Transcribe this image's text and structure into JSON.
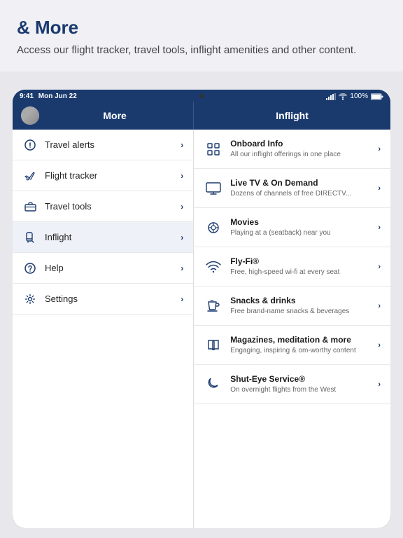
{
  "page": {
    "background_color": "#e8e8ec"
  },
  "top": {
    "title": "& More",
    "subtitle": "Access our flight tracker, travel tools, inflight amenities and other content."
  },
  "status_bar": {
    "time": "9:41",
    "date": "Mon Jun 22",
    "battery": "100%"
  },
  "left_nav": {
    "title": "More",
    "items": [
      {
        "id": "travel-alerts",
        "label": "Travel alerts",
        "icon": "alert-circle",
        "active": false
      },
      {
        "id": "flight-tracker",
        "label": "Flight tracker",
        "icon": "plane",
        "active": false
      },
      {
        "id": "travel-tools",
        "label": "Travel tools",
        "icon": "briefcase",
        "active": false
      },
      {
        "id": "inflight",
        "label": "Inflight",
        "icon": "seat",
        "active": true
      },
      {
        "id": "help",
        "label": "Help",
        "icon": "help-circle",
        "active": false
      },
      {
        "id": "settings",
        "label": "Settings",
        "icon": "gear",
        "active": false
      }
    ]
  },
  "right_nav": {
    "title": "Inflight",
    "items": [
      {
        "id": "onboard-info",
        "title": "Onboard Info",
        "subtitle": "All our inflight offerings in one place",
        "icon": "grid"
      },
      {
        "id": "live-tv",
        "title": "Live TV & On Demand",
        "subtitle": "Dozens of channels of free DIRECTV...",
        "icon": "tv"
      },
      {
        "id": "movies",
        "title": "Movies",
        "subtitle": "Playing at a (seatback) near you",
        "icon": "film"
      },
      {
        "id": "fly-fi",
        "title": "Fly-Fi®",
        "subtitle": "Free, high-speed wi-fi at every seat",
        "icon": "wifi"
      },
      {
        "id": "snacks-drinks",
        "title": "Snacks & drinks",
        "subtitle": "Free brand-name snacks & beverages",
        "icon": "coffee"
      },
      {
        "id": "magazines",
        "title": "Magazines, meditation & more",
        "subtitle": "Engaging, inspiring & om-worthy content",
        "icon": "book"
      },
      {
        "id": "shut-eye",
        "title": "Shut-Eye Service®",
        "subtitle": "On overnight flights from the West",
        "icon": "moon"
      }
    ]
  }
}
